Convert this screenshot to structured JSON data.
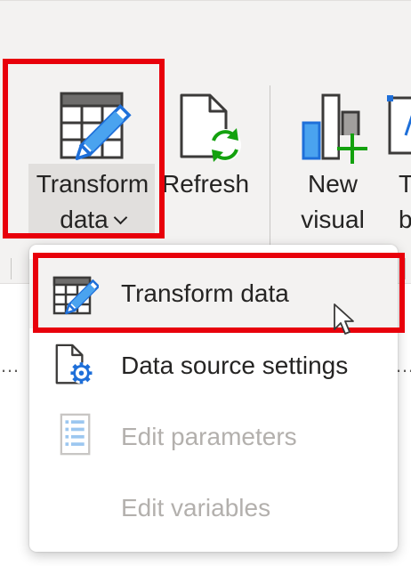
{
  "ribbon": {
    "transform_data": {
      "line1": "Transform",
      "line2": "data",
      "icon": "table-edit-icon"
    },
    "refresh": {
      "label": "Refresh",
      "icon": "refresh-document-icon"
    },
    "new_visual": {
      "line1": "New",
      "line2": "visual",
      "icon": "new-visual-icon"
    },
    "text_box": {
      "line1": "T",
      "line2": "b",
      "icon": "text-box-icon"
    }
  },
  "dropdown": {
    "items": [
      {
        "label": "Transform data",
        "icon": "table-edit-icon",
        "state": "hovered"
      },
      {
        "label": "Data source settings",
        "icon": "document-gear-icon",
        "state": "enabled"
      },
      {
        "label": "Edit parameters",
        "icon": "parameters-list-icon",
        "state": "disabled"
      },
      {
        "label": "Edit variables",
        "icon": "",
        "state": "disabled"
      }
    ]
  },
  "colors": {
    "highlight": "#e8000b",
    "pencil_blue": "#1e6fd9",
    "refresh_green": "#13a10e",
    "disabled_text": "#b3b0ad",
    "ribbon_bg": "#f3f2f1"
  }
}
